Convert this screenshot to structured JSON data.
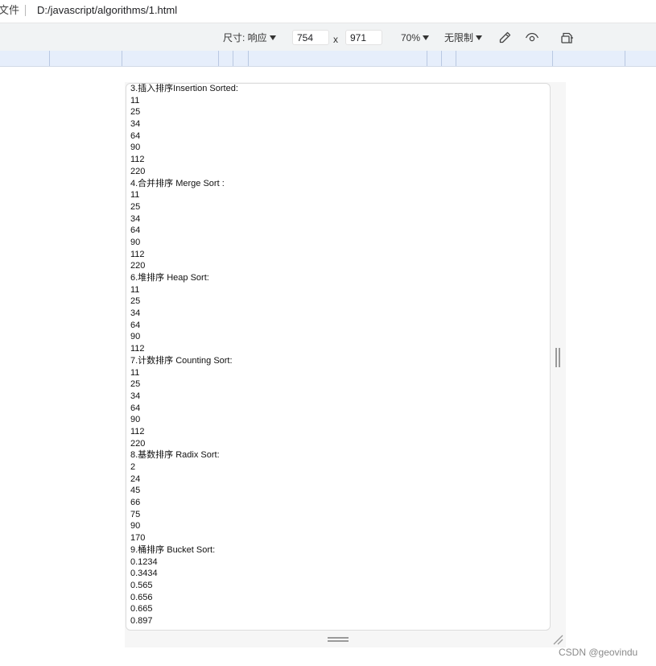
{
  "address_bar": {
    "file_label": "文件",
    "url": "D:/javascript/algorithms/1.html"
  },
  "device_toolbar": {
    "dimensions_label": "尺寸: 响应",
    "width": "754",
    "times": "x",
    "height": "971",
    "zoom": "70%",
    "throttle": "无限制",
    "icons": [
      "eyedropper-icon",
      "eye-icon",
      "rotate-icon"
    ]
  },
  "page": {
    "lines": [
      "3.插入排序Insertion Sorted:",
      "11",
      "25",
      "34",
      "64",
      "90",
      "112",
      "220",
      "4.合并排序 Merge Sort :",
      "11",
      "25",
      "34",
      "64",
      "90",
      "112",
      "220",
      "6.堆排序 Heap Sort:",
      "11",
      "25",
      "34",
      "64",
      "90",
      "112",
      "7.计数排序 Counting Sort:",
      "11",
      "25",
      "34",
      "64",
      "90",
      "112",
      "220",
      "8.基数排序 Radix Sort:",
      "2",
      "24",
      "45",
      "66",
      "75",
      "90",
      "170",
      "9.桶排序 Bucket Sort:",
      "0.1234",
      "0.3434",
      "0.565",
      "0.656",
      "0.665",
      "0.897"
    ]
  },
  "watermark": "CSDN @geovindu"
}
